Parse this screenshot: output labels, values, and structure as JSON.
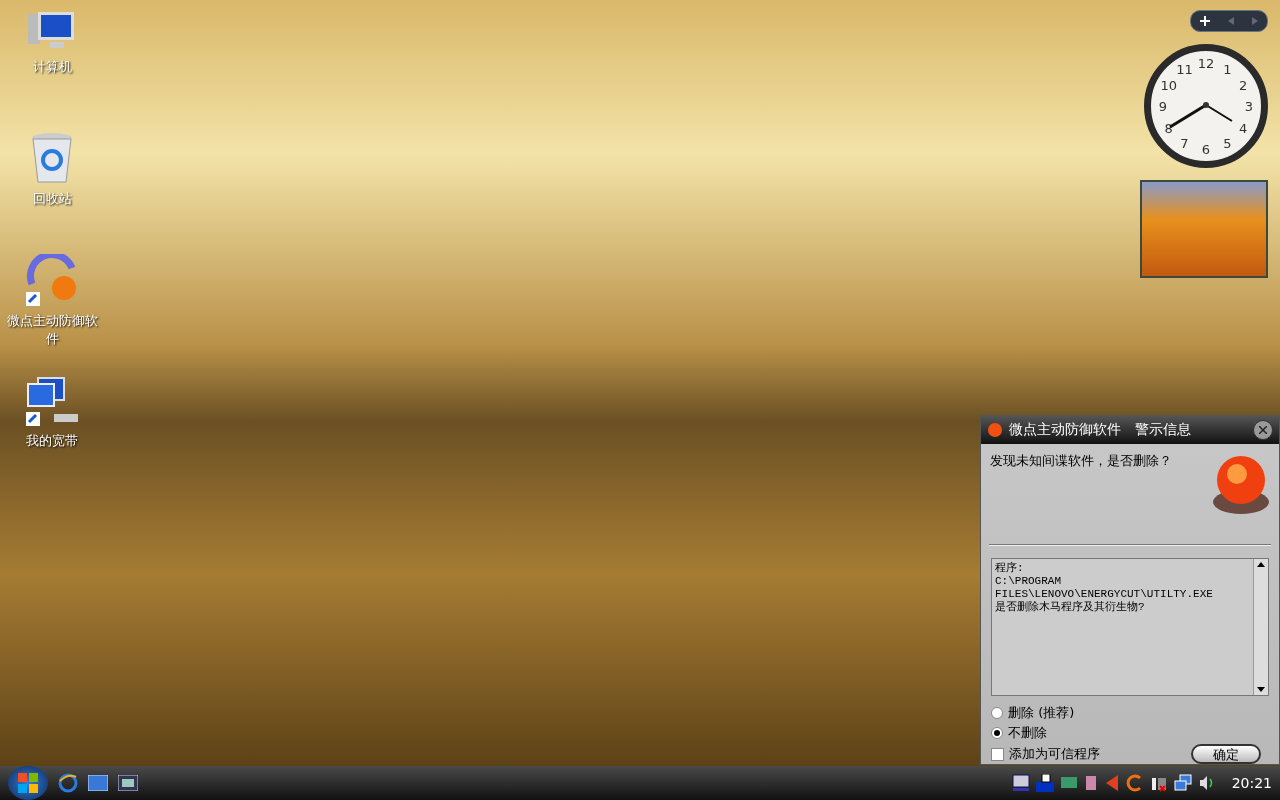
{
  "desktop_icons": [
    {
      "kind": "computer",
      "label": "计算机"
    },
    {
      "kind": "recycle",
      "label": "回收站"
    },
    {
      "kind": "shield",
      "label": "微点主动防御软件"
    },
    {
      "kind": "network",
      "label": "我的宽带"
    }
  ],
  "clock_gadget": {
    "numerals": [
      "12",
      "11",
      "1",
      "10",
      "2",
      "9",
      "3",
      "8",
      "4",
      "7",
      "5",
      "6"
    ]
  },
  "dialog": {
    "title": "微点主动防御软件　警示信息",
    "message": "发现未知间谍软件，是否删除？",
    "details": [
      "程序:",
      "C:\\PROGRAM",
      "FILES\\LENOVO\\ENERGYCUT\\UTILTY.EXE",
      "是否删除木马程序及其衍生物?"
    ],
    "options": [
      {
        "label": "删除 (推荐)",
        "selected": false
      },
      {
        "label": "不删除",
        "selected": true
      }
    ],
    "trust_checkbox": {
      "label": "添加为可信程序",
      "checked": false
    },
    "ok_button": "确定"
  },
  "taskbar": {
    "time": "20:21"
  }
}
